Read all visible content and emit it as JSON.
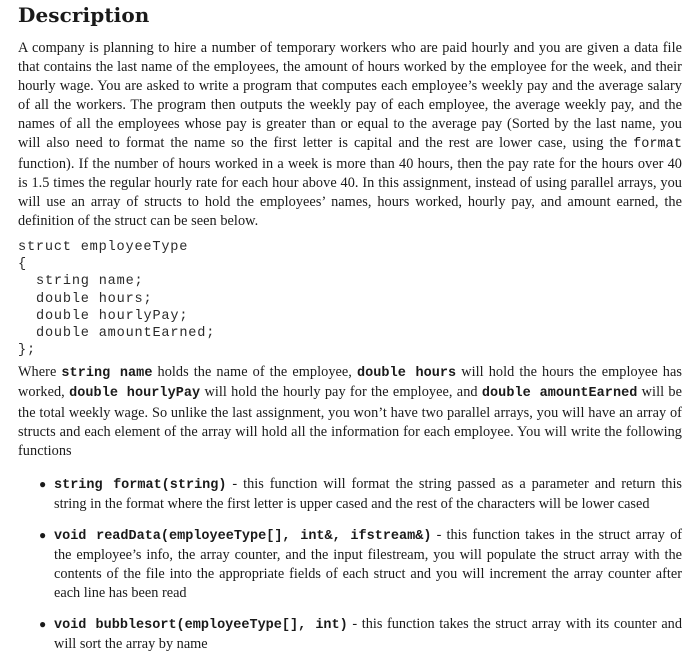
{
  "title": "Description",
  "intro": {
    "part1": "A company is planning to hire a number of temporary workers who are paid hourly and you are given a data file that contains the last name of the employees, the amount of hours worked by the employee for the week, and their hourly wage. You are asked to write a program that computes each employee’s weekly pay and the average salary of all the workers. The program then outputs the weekly pay of each employee, the average weekly pay, and the names of all the employees whose pay is greater than or equal to the average pay (Sorted by the last name, you will also need to format the name so the first letter is capital and the rest are lower case, using the ",
    "format_code": "format",
    "part2": " function). If the number of hours worked in a week is more than 40 hours, then the pay rate for the hours over 40 is 1.5 times the regular hourly rate for each hour above 40. In this assignment, instead of using parallel arrays, you will use an array of structs to hold the employees’ names, hours worked, hourly pay, and amount earned, the definition of the struct can be seen below."
  },
  "struct_code": {
    "header": "struct employeeType",
    "open": "{",
    "fields": [
      "string name;",
      "double hours;",
      "double hourlyPay;",
      "double amountEarned;"
    ],
    "close": "};"
  },
  "explanation": {
    "t1": "Where ",
    "c1": "string name",
    "t2": " holds the name of the employee, ",
    "c2": "double hours",
    "t3": " will hold the hours the employee has worked, ",
    "c3": "double hourlyPay",
    "t4": " will hold the hourly pay for the employee, and ",
    "c4": "double amountEarned",
    "t5": " will be the total weekly wage. So unlike the last assignment, you won’t have two parallel arrays, you will have an array of structs and each element of the array will hold all the information for each employee. You will write the following functions"
  },
  "functions": [
    {
      "signature": "string format(string)",
      "description": " - this function will format the string passed as a parameter and return this string in the format where the first letter is upper cased and the rest of the characters will be lower cased"
    },
    {
      "signature": "void readData(employeeType[], int&, ifstream&)",
      "description": " - this function takes in the struct array of the employee’s info, the array counter, and the input filestream, you will populate the struct array with the contents of the file into the appropriate fields of each struct and you will increment the array counter after each line has been read"
    },
    {
      "signature": "void bubblesort(employeeType[], int)",
      "description": " - this function takes the struct array with its counter and will sort the array by name"
    }
  ],
  "bullet_glyph": "●"
}
